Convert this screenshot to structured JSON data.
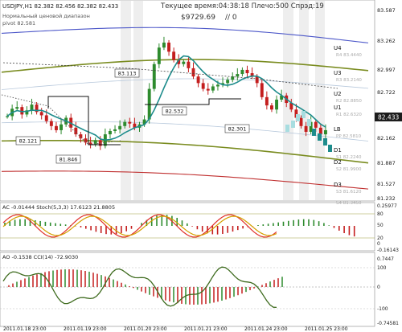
{
  "header": {
    "symbol_line": "USDJPY,H1  82.382 82.456 82.382 82.433",
    "normal_range": "Нормальный ценовой диапазон",
    "pivot_label": "pivot 82.581",
    "time_line": "Текущее время:04:38:18 Плечо:500 Спрэд:19",
    "balance": "$9729.69",
    "slash": "// 0"
  },
  "price_panel": {
    "y_ticks": [
      "83.587",
      "83.262",
      "82.997",
      "82.722",
      "82.433",
      "82.162",
      "81.887",
      "81.527",
      "81.232"
    ],
    "current_price": "82.433",
    "levels": [
      {
        "label": "U4",
        "value": "83.4440",
        "ghost": "R4 83.4440"
      },
      {
        "label": "U3",
        "value": "83.2140",
        "ghost": "R3 83.2140"
      },
      {
        "label": "U2",
        "value": "82.8850",
        "ghost": "R2 82.8850"
      },
      {
        "label": "U1",
        "value": "82.6320",
        "ghost": "R1 82.6320"
      },
      {
        "label": "LB",
        "value": "82.5810",
        "ghost": "PP 82.5810"
      },
      {
        "label": "D1",
        "value": "82.2240",
        "ghost": "S1 82.2240"
      },
      {
        "label": "D2",
        "value": "81.9900",
        "ghost": "S2 81.9900"
      },
      {
        "label": "D3",
        "value": "81.6120",
        "ghost": "S3 81.6120"
      },
      {
        "label": "",
        "value": "81.3450",
        "ghost": "S4 81.3450"
      }
    ],
    "callouts": [
      "83.113",
      "82.532",
      "82.301",
      "82.121",
      "81.846"
    ]
  },
  "ac_panel": {
    "title": "AC -0.01444   Stoch(5,3,3) 17.6123 21.8805",
    "y_ticks": [
      "0.25977",
      "80",
      "50",
      "20",
      "0",
      "-0.16143"
    ]
  },
  "ao_panel": {
    "title": "AO -0.1538   CCI(14) -72.9030",
    "y_ticks": [
      "0.7447",
      "100",
      "0",
      "-100",
      "-0.74581"
    ]
  },
  "x_axis": {
    "labels": [
      "2011.01.18 23:00",
      "2011.01.19 23:00",
      "2011.01.20 23:00",
      "2011.01.21 23:00",
      "2011.01.24 23:00",
      "2011.01.25 23:00"
    ]
  },
  "chart_data": {
    "type": "candlestick",
    "symbol": "USDJPY",
    "timeframe": "H1",
    "last_price": 82.433,
    "price_range": [
      81.232,
      83.587
    ],
    "close_series": [
      82.22,
      82.31,
      82.33,
      82.24,
      82.29,
      82.36,
      82.27,
      82.23,
      82.16,
      82.1,
      82.05,
      82.12,
      82.2,
      82.08,
      82.0,
      81.95,
      81.9,
      81.88,
      81.93,
      81.86,
      82.0,
      82.04,
      82.06,
      82.1,
      82.15,
      82.13,
      82.08,
      82.12,
      82.18,
      82.55,
      82.85,
      83.05,
      83.11,
      83.0,
      82.9,
      82.85,
      82.88,
      82.8,
      82.7,
      82.62,
      82.55,
      82.53,
      82.58,
      82.6,
      82.62,
      82.66,
      82.7,
      82.73,
      82.78,
      82.74,
      82.7,
      82.62,
      82.45,
      82.35,
      82.3,
      82.42,
      82.47,
      82.38,
      82.3,
      82.2,
      82.1,
      82.03,
      82.15,
      82.08,
      82.0,
      82.05
    ],
    "pivot_levels": {
      "U4": 83.444,
      "U3": 83.214,
      "U2": 82.885,
      "U1": 82.632,
      "LB": 82.581,
      "D1": 82.224,
      "D2": 81.99,
      "D3": 81.612
    }
  }
}
